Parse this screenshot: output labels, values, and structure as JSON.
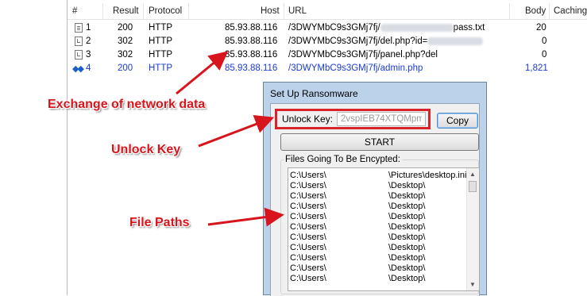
{
  "grid": {
    "columns": [
      "#",
      "Result",
      "Protocol",
      "Host",
      "URL",
      "Body",
      "Caching"
    ],
    "rows": [
      {
        "num": "1",
        "result": "200",
        "protocol": "HTTP",
        "host": "85.93.88.116",
        "url_prefix": "/3DWYMbC9s3GMj7fj/",
        "url_suffix": "pass.txt",
        "body": "20",
        "icon": "document-icon"
      },
      {
        "num": "2",
        "result": "302",
        "protocol": "HTTP",
        "host": "85.93.88.116",
        "url_prefix": "/3DWYMbC9s3GMj7fj/del.php?id=",
        "url_suffix": "",
        "body": "0",
        "icon": "redirect-icon"
      },
      {
        "num": "3",
        "result": "302",
        "protocol": "HTTP",
        "host": "85.93.88.116",
        "url_prefix": "/3DWYMbC9s3GMj7fj/panel.php?del",
        "url_suffix": "",
        "body": "0",
        "icon": "redirect-icon"
      },
      {
        "num": "4",
        "result": "200",
        "protocol": "HTTP",
        "host": "85.93.88.116",
        "url_prefix": "/3DWYMbC9s3GMj7fj/admin.php",
        "url_suffix": "",
        "body": "1,821",
        "icon": "diamond-arrows-icon"
      }
    ]
  },
  "dialog": {
    "title": "Set Up Ransomware",
    "unlock_label": "Unlock Key:",
    "unlock_value": "2vspIEB74XTQMpm",
    "copy_label": "Copy",
    "start_label": "START",
    "files_label": "Files Going To Be Encypted:",
    "files": [
      {
        "a": "C:\\Users\\",
        "b": "\\Pictures\\desktop.ini"
      },
      {
        "a": "C:\\Users\\",
        "b": "\\Desktop\\"
      },
      {
        "a": "C:\\Users\\",
        "b": "\\Desktop\\"
      },
      {
        "a": "C:\\Users\\",
        "b": "\\Desktop\\"
      },
      {
        "a": "C:\\Users\\",
        "b": "\\Desktop\\"
      },
      {
        "a": "C:\\Users\\",
        "b": "\\Desktop\\"
      },
      {
        "a": "C:\\Users\\",
        "b": "\\Desktop\\"
      },
      {
        "a": "C:\\Users\\",
        "b": "\\Desktop\\"
      },
      {
        "a": "C:\\Users\\",
        "b": "\\Desktop\\"
      },
      {
        "a": "C:\\Users\\",
        "b": "\\Desktop\\"
      },
      {
        "a": "C:\\Users\\",
        "b": "\\Desktop\\"
      }
    ]
  },
  "annotations": {
    "network": "Exchange of  network data",
    "unlock": "Unlock Key",
    "paths": "File Paths"
  },
  "colors": {
    "annotation_red": "#d8141c",
    "selected_row_blue": "#1a3bd6",
    "dialog_frame": "#bcd2ea"
  }
}
